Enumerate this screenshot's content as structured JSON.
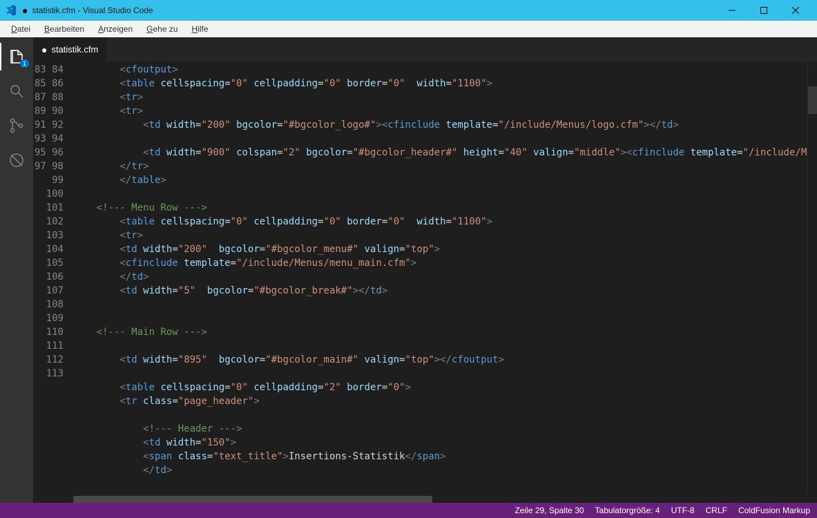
{
  "window": {
    "filename": "statistik.cfm",
    "appname": "Visual Studio Code",
    "title": "statistik.cfm - Visual Studio Code",
    "dirty_mark": "●"
  },
  "menubar": {
    "items": [
      {
        "label": "Datei",
        "mnemonic_index": 0
      },
      {
        "label": "Bearbeiten",
        "mnemonic_index": 0
      },
      {
        "label": "Anzeigen",
        "mnemonic_index": 0
      },
      {
        "label": "Gehe zu",
        "mnemonic_index": 0
      },
      {
        "label": "Hilfe",
        "mnemonic_index": 0
      }
    ]
  },
  "activitybar": {
    "badge": "1"
  },
  "tab": {
    "dirty_mark": "●",
    "label": "statistik.cfm"
  },
  "gutter": {
    "start": 83,
    "end": 113
  },
  "code": {
    "lines": [
      [
        [
          "        ",
          " "
        ],
        [
          "<",
          "t-punct"
        ],
        [
          "cfoutput",
          "t-tag"
        ],
        [
          ">",
          "t-punct"
        ]
      ],
      [
        [
          "        ",
          " "
        ],
        [
          "<",
          "t-punct"
        ],
        [
          "table",
          "t-tag"
        ],
        [
          " ",
          "t-text"
        ],
        [
          "cellspacing",
          "t-attr"
        ],
        [
          "=",
          "t-op"
        ],
        [
          "\"0\"",
          "t-str"
        ],
        [
          " ",
          "t-text"
        ],
        [
          "cellpadding",
          "t-attr"
        ],
        [
          "=",
          "t-op"
        ],
        [
          "\"0\"",
          "t-str"
        ],
        [
          " ",
          "t-text"
        ],
        [
          "border",
          "t-attr"
        ],
        [
          "=",
          "t-op"
        ],
        [
          "\"0\"",
          "t-str"
        ],
        [
          "  ",
          "t-text"
        ],
        [
          "width",
          "t-attr"
        ],
        [
          "=",
          "t-op"
        ],
        [
          "\"1100\"",
          "t-str"
        ],
        [
          ">",
          "t-punct"
        ]
      ],
      [
        [
          "        ",
          " "
        ],
        [
          "<",
          "t-punct"
        ],
        [
          "tr",
          "t-tag"
        ],
        [
          ">",
          "t-punct"
        ]
      ],
      [
        [
          "        ",
          " "
        ],
        [
          "<",
          "t-punct"
        ],
        [
          "tr",
          "t-tag"
        ],
        [
          ">",
          "t-punct"
        ]
      ],
      [
        [
          "            ",
          " "
        ],
        [
          "<",
          "t-punct"
        ],
        [
          "td",
          "t-tag"
        ],
        [
          " ",
          "t-text"
        ],
        [
          "width",
          "t-attr"
        ],
        [
          "=",
          "t-op"
        ],
        [
          "\"200\"",
          "t-str"
        ],
        [
          " ",
          "t-text"
        ],
        [
          "bgcolor",
          "t-attr"
        ],
        [
          "=",
          "t-op"
        ],
        [
          "\"#bgcolor_logo#\"",
          "t-str"
        ],
        [
          "><",
          "t-punct"
        ],
        [
          "cfinclude",
          "t-tag"
        ],
        [
          " ",
          "t-text"
        ],
        [
          "template",
          "t-attr"
        ],
        [
          "=",
          "t-op"
        ],
        [
          "\"/include/Menus/logo.cfm\"",
          "t-str"
        ],
        [
          "></",
          "t-punct"
        ],
        [
          "td",
          "t-tag"
        ],
        [
          ">",
          "t-punct"
        ]
      ],
      [],
      [
        [
          "            ",
          " "
        ],
        [
          "<",
          "t-punct"
        ],
        [
          "td",
          "t-tag"
        ],
        [
          " ",
          "t-text"
        ],
        [
          "width",
          "t-attr"
        ],
        [
          "=",
          "t-op"
        ],
        [
          "\"900\"",
          "t-str"
        ],
        [
          " ",
          "t-text"
        ],
        [
          "colspan",
          "t-attr"
        ],
        [
          "=",
          "t-op"
        ],
        [
          "\"2\"",
          "t-str"
        ],
        [
          " ",
          "t-text"
        ],
        [
          "bgcolor",
          "t-attr"
        ],
        [
          "=",
          "t-op"
        ],
        [
          "\"#bgcolor_header#\"",
          "t-str"
        ],
        [
          " ",
          "t-text"
        ],
        [
          "height",
          "t-attr"
        ],
        [
          "=",
          "t-op"
        ],
        [
          "\"40\"",
          "t-str"
        ],
        [
          " ",
          "t-text"
        ],
        [
          "valign",
          "t-attr"
        ],
        [
          "=",
          "t-op"
        ],
        [
          "\"middle\"",
          "t-str"
        ],
        [
          "><",
          "t-punct"
        ],
        [
          "cfinclude",
          "t-tag"
        ],
        [
          " ",
          "t-text"
        ],
        [
          "template",
          "t-attr"
        ],
        [
          "=",
          "t-op"
        ],
        [
          "\"/include/Menus/hea",
          "t-str"
        ]
      ],
      [
        [
          "        ",
          " "
        ],
        [
          "</",
          "t-punct"
        ],
        [
          "tr",
          "t-tag"
        ],
        [
          ">",
          "t-punct"
        ]
      ],
      [
        [
          "        ",
          " "
        ],
        [
          "</",
          "t-punct"
        ],
        [
          "table",
          "t-tag"
        ],
        [
          ">",
          "t-punct"
        ]
      ],
      [],
      [
        [
          "    ",
          " "
        ],
        [
          "<!--- Menu Row --->",
          "t-comment"
        ]
      ],
      [
        [
          "        ",
          " "
        ],
        [
          "<",
          "t-punct"
        ],
        [
          "table",
          "t-tag"
        ],
        [
          " ",
          "t-text"
        ],
        [
          "cellspacing",
          "t-attr"
        ],
        [
          "=",
          "t-op"
        ],
        [
          "\"0\"",
          "t-str"
        ],
        [
          " ",
          "t-text"
        ],
        [
          "cellpadding",
          "t-attr"
        ],
        [
          "=",
          "t-op"
        ],
        [
          "\"0\"",
          "t-str"
        ],
        [
          " ",
          "t-text"
        ],
        [
          "border",
          "t-attr"
        ],
        [
          "=",
          "t-op"
        ],
        [
          "\"0\"",
          "t-str"
        ],
        [
          "  ",
          "t-text"
        ],
        [
          "width",
          "t-attr"
        ],
        [
          "=",
          "t-op"
        ],
        [
          "\"1100\"",
          "t-str"
        ],
        [
          ">",
          "t-punct"
        ]
      ],
      [
        [
          "        ",
          " "
        ],
        [
          "<",
          "t-punct"
        ],
        [
          "tr",
          "t-tag"
        ],
        [
          ">",
          "t-punct"
        ]
      ],
      [
        [
          "        ",
          " "
        ],
        [
          "<",
          "t-punct"
        ],
        [
          "td",
          "t-tag"
        ],
        [
          " ",
          "t-text"
        ],
        [
          "width",
          "t-attr"
        ],
        [
          "=",
          "t-op"
        ],
        [
          "\"200\"",
          "t-str"
        ],
        [
          "  ",
          "t-text"
        ],
        [
          "bgcolor",
          "t-attr"
        ],
        [
          "=",
          "t-op"
        ],
        [
          "\"#bgcolor_menu#\"",
          "t-str"
        ],
        [
          " ",
          "t-text"
        ],
        [
          "valign",
          "t-attr"
        ],
        [
          "=",
          "t-op"
        ],
        [
          "\"top\"",
          "t-str"
        ],
        [
          ">",
          "t-punct"
        ]
      ],
      [
        [
          "        ",
          " "
        ],
        [
          "<",
          "t-punct"
        ],
        [
          "cfinclude",
          "t-tag"
        ],
        [
          " ",
          "t-text"
        ],
        [
          "template",
          "t-attr"
        ],
        [
          "=",
          "t-op"
        ],
        [
          "\"/include/Menus/menu_main.cfm\"",
          "t-str"
        ],
        [
          ">",
          "t-punct"
        ]
      ],
      [
        [
          "        ",
          " "
        ],
        [
          "</",
          "t-punct"
        ],
        [
          "td",
          "t-tag"
        ],
        [
          ">",
          "t-punct"
        ]
      ],
      [
        [
          "        ",
          " "
        ],
        [
          "<",
          "t-punct"
        ],
        [
          "td",
          "t-tag"
        ],
        [
          " ",
          "t-text"
        ],
        [
          "width",
          "t-attr"
        ],
        [
          "=",
          "t-op"
        ],
        [
          "\"5\"",
          "t-str"
        ],
        [
          "  ",
          "t-text"
        ],
        [
          "bgcolor",
          "t-attr"
        ],
        [
          "=",
          "t-op"
        ],
        [
          "\"#bgcolor_break#\"",
          "t-str"
        ],
        [
          "></",
          "t-punct"
        ],
        [
          "td",
          "t-tag"
        ],
        [
          ">",
          "t-punct"
        ]
      ],
      [],
      [],
      [
        [
          "    ",
          " "
        ],
        [
          "<!--- Main Row --->",
          "t-comment"
        ]
      ],
      [],
      [
        [
          "        ",
          " "
        ],
        [
          "<",
          "t-punct"
        ],
        [
          "td",
          "t-tag"
        ],
        [
          " ",
          "t-text"
        ],
        [
          "width",
          "t-attr"
        ],
        [
          "=",
          "t-op"
        ],
        [
          "\"895\"",
          "t-str"
        ],
        [
          "  ",
          "t-text"
        ],
        [
          "bgcolor",
          "t-attr"
        ],
        [
          "=",
          "t-op"
        ],
        [
          "\"#bgcolor_main#\"",
          "t-str"
        ],
        [
          " ",
          "t-text"
        ],
        [
          "valign",
          "t-attr"
        ],
        [
          "=",
          "t-op"
        ],
        [
          "\"top\"",
          "t-str"
        ],
        [
          "></",
          "t-punct"
        ],
        [
          "cfoutput",
          "t-tag"
        ],
        [
          ">",
          "t-punct"
        ]
      ],
      [],
      [
        [
          "        ",
          " "
        ],
        [
          "<",
          "t-punct"
        ],
        [
          "table",
          "t-tag"
        ],
        [
          " ",
          "t-text"
        ],
        [
          "cellspacing",
          "t-attr"
        ],
        [
          "=",
          "t-op"
        ],
        [
          "\"0\"",
          "t-str"
        ],
        [
          " ",
          "t-text"
        ],
        [
          "cellpadding",
          "t-attr"
        ],
        [
          "=",
          "t-op"
        ],
        [
          "\"2\"",
          "t-str"
        ],
        [
          " ",
          "t-text"
        ],
        [
          "border",
          "t-attr"
        ],
        [
          "=",
          "t-op"
        ],
        [
          "\"0\"",
          "t-str"
        ],
        [
          ">",
          "t-punct"
        ]
      ],
      [
        [
          "        ",
          " "
        ],
        [
          "<",
          "t-punct"
        ],
        [
          "tr",
          "t-tag"
        ],
        [
          " ",
          "t-text"
        ],
        [
          "class",
          "t-attr"
        ],
        [
          "=",
          "t-op"
        ],
        [
          "\"page_header\"",
          "t-str"
        ],
        [
          ">",
          "t-punct"
        ]
      ],
      [],
      [
        [
          "            ",
          " "
        ],
        [
          "<!--- Header --->",
          "t-comment"
        ]
      ],
      [
        [
          "            ",
          " "
        ],
        [
          "<",
          "t-punct"
        ],
        [
          "td",
          "t-tag"
        ],
        [
          " ",
          "t-text"
        ],
        [
          "width",
          "t-attr"
        ],
        [
          "=",
          "t-op"
        ],
        [
          "\"150\"",
          "t-str"
        ],
        [
          ">",
          "t-punct"
        ]
      ],
      [
        [
          "            ",
          " "
        ],
        [
          "<",
          "t-punct"
        ],
        [
          "span",
          "t-tag"
        ],
        [
          " ",
          "t-text"
        ],
        [
          "class",
          "t-attr"
        ],
        [
          "=",
          "t-op"
        ],
        [
          "\"text_title\"",
          "t-str"
        ],
        [
          ">",
          "t-punct"
        ],
        [
          "Insertions-Statistik",
          "t-text"
        ],
        [
          "</",
          "t-punct"
        ],
        [
          "span",
          "t-tag"
        ],
        [
          ">",
          "t-punct"
        ]
      ],
      [
        [
          "            ",
          " "
        ],
        [
          "</",
          "t-punct"
        ],
        [
          "td",
          "t-tag"
        ],
        [
          ">",
          "t-punct"
        ]
      ],
      []
    ]
  },
  "statusbar": {
    "position": "Zeile 29, Spalte 30",
    "tabsize": "Tabulatorgröße: 4",
    "encoding": "UTF-8",
    "eol": "CRLF",
    "language": "ColdFusion Markup"
  }
}
